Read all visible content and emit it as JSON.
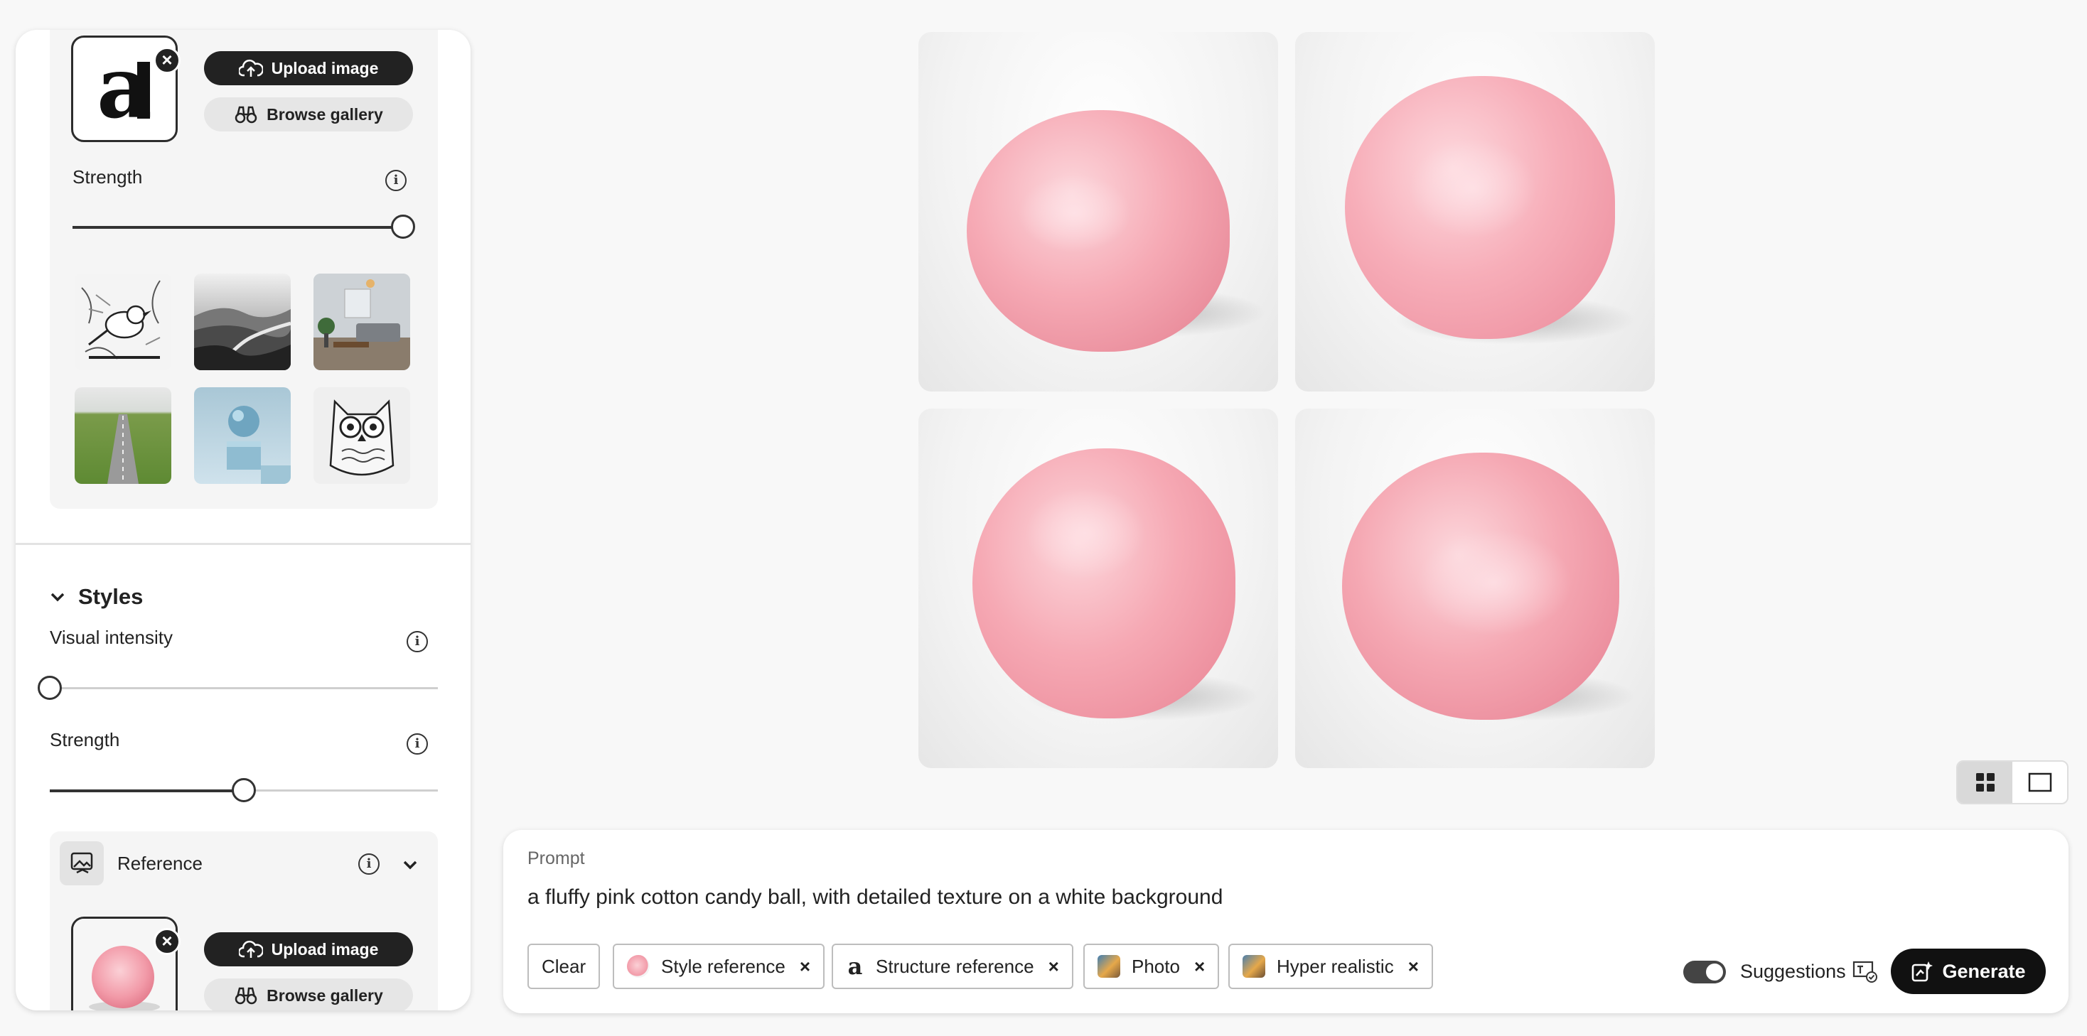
{
  "structure_section": {
    "upload_label": "Upload image",
    "browse_label": "Browse gallery",
    "strength_label": "Strength",
    "strength_value": 1.0,
    "presets": [
      "bird-sketch",
      "misty-landscape",
      "living-room",
      "road-through-fields",
      "blue-sphere",
      "owl-drawing"
    ]
  },
  "styles_section": {
    "title": "Styles",
    "visual_intensity_label": "Visual intensity",
    "visual_intensity_value": 0.0,
    "strength_label": "Strength",
    "strength_value": 0.5,
    "reference": {
      "label": "Reference",
      "upload_label": "Upload image",
      "browse_label": "Browse gallery"
    }
  },
  "results": {
    "images": [
      "cotton-candy-1",
      "cotton-candy-2",
      "cotton-candy-3",
      "cotton-candy-4"
    ]
  },
  "prompt": {
    "label": "Prompt",
    "text": "a fluffy pink cotton candy ball, with detailed texture on a white background",
    "clear_label": "Clear",
    "chips": [
      {
        "label": "Style reference"
      },
      {
        "label": "Structure reference"
      },
      {
        "label": "Photo"
      },
      {
        "label": "Hyper realistic"
      }
    ],
    "suggestions_label": "Suggestions",
    "suggestions_on": true,
    "generate_label": "Generate"
  },
  "colors": {
    "accent_dark": "#222222",
    "cotton_candy": "#f4a5b0"
  }
}
